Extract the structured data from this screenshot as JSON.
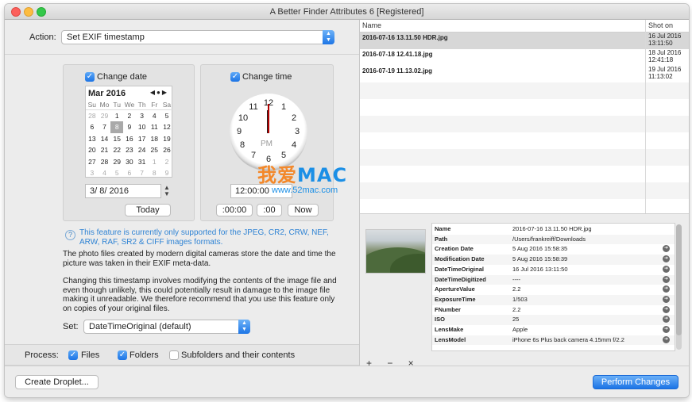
{
  "window": {
    "title": "A Better Finder Attributes 6 [Registered]"
  },
  "action": {
    "label": "Action:",
    "value": "Set EXIF timestamp"
  },
  "date_panel": {
    "checkbox_label": "Change date",
    "month": "Mar 2016",
    "weekdays": [
      "Su",
      "Mo",
      "Tu",
      "We",
      "Th",
      "Fr",
      "Sa"
    ],
    "days": [
      {
        "d": "28",
        "dim": true
      },
      {
        "d": "29",
        "dim": true
      },
      {
        "d": "1"
      },
      {
        "d": "2"
      },
      {
        "d": "3"
      },
      {
        "d": "4"
      },
      {
        "d": "5"
      },
      {
        "d": "6"
      },
      {
        "d": "7"
      },
      {
        "d": "8",
        "sel": true
      },
      {
        "d": "9"
      },
      {
        "d": "10"
      },
      {
        "d": "11"
      },
      {
        "d": "12"
      },
      {
        "d": "13"
      },
      {
        "d": "14"
      },
      {
        "d": "15"
      },
      {
        "d": "16"
      },
      {
        "d": "17"
      },
      {
        "d": "18"
      },
      {
        "d": "19"
      },
      {
        "d": "20"
      },
      {
        "d": "21"
      },
      {
        "d": "22"
      },
      {
        "d": "23"
      },
      {
        "d": "24"
      },
      {
        "d": "25"
      },
      {
        "d": "26"
      },
      {
        "d": "27"
      },
      {
        "d": "28"
      },
      {
        "d": "29"
      },
      {
        "d": "30"
      },
      {
        "d": "31"
      },
      {
        "d": "1",
        "dim": true
      },
      {
        "d": "2",
        "dim": true
      },
      {
        "d": "3",
        "dim": true
      },
      {
        "d": "4",
        "dim": true
      },
      {
        "d": "5",
        "dim": true
      },
      {
        "d": "6",
        "dim": true
      },
      {
        "d": "7",
        "dim": true
      },
      {
        "d": "8",
        "dim": true
      },
      {
        "d": "9",
        "dim": true
      }
    ],
    "date_value": "3/  8/ 2016",
    "today_button": "Today"
  },
  "time_panel": {
    "checkbox_label": "Change time",
    "clock_numbers": [
      "12",
      "1",
      "2",
      "3",
      "4",
      "5",
      "6",
      "7",
      "8",
      "9",
      "10",
      "11"
    ],
    "pm_label": "PM",
    "time_value": "12:00:00",
    "btn_min": ":00:00",
    "btn_sec": ":00",
    "btn_now": "Now"
  },
  "info_icon": "?",
  "info_text": "This feature is currently only supported for the JPEG, CR2, CRW, NEF, ARW, RAF, SR2 & CIFF images formats.",
  "para1": "The photo files created by modern digital cameras store the date and time the picture was taken in their EXIF meta-data.",
  "para2": "Changing this timestamp involves modifying the contents of the image file and even though unlikely, this could potentially result in damage to the image file making it unreadable. We therefore recommend that you use this feature only on copies of your original files.",
  "set": {
    "label": "Set:",
    "value": "DateTimeOriginal (default)"
  },
  "process": {
    "label": "Process:",
    "files": "Files",
    "folders": "Folders",
    "subfolders": "Subfolders and their contents"
  },
  "bottom": {
    "create_droplet": "Create Droplet...",
    "perform": "Perform Changes"
  },
  "file_table": {
    "col_name": "Name",
    "col_shot": "Shot on",
    "rows": [
      {
        "name": "2016-07-16 13.11.50 HDR.jpg",
        "date1": "16 Jul 2016",
        "date2": "13:11:50"
      },
      {
        "name": "2016-07-18 12.41.18.jpg",
        "date1": "18 Jul 2016",
        "date2": "12:41:18"
      },
      {
        "name": "2016-07-19 11.13.02.jpg",
        "date1": "19 Jul 2016",
        "date2": "11:13:02"
      }
    ]
  },
  "metadata": {
    "rows": [
      {
        "k": "Name",
        "v": "2016-07-16 13.11.50 HDR.jpg",
        "arrow": false
      },
      {
        "k": "Path",
        "v": "/Users/frankreiff/Downloads",
        "arrow": false
      },
      {
        "k": "Creation Date",
        "v": "5 Aug 2016 15:58:35",
        "arrow": true
      },
      {
        "k": "Modification Date",
        "v": "5 Aug 2016 15:58:39",
        "arrow": true
      },
      {
        "k": "DateTimeOriginal",
        "v": "16 Jul 2016 13:11:50",
        "arrow": true
      },
      {
        "k": "DateTimeDigitized",
        "v": "----",
        "arrow": true
      },
      {
        "k": "ApertureValue",
        "v": "2.2",
        "arrow": true
      },
      {
        "k": "ExposureTime",
        "v": "1/503",
        "arrow": true
      },
      {
        "k": "FNumber",
        "v": "2.2",
        "arrow": true
      },
      {
        "k": "ISO",
        "v": "25",
        "arrow": true
      },
      {
        "k": "LensMake",
        "v": "Apple",
        "arrow": true
      },
      {
        "k": "LensModel",
        "v": "iPhone 6s Plus back camera 4.15mm f/2.2",
        "arrow": true
      }
    ],
    "tools": "+ − ×"
  },
  "watermark": {
    "big_cn": "我爱",
    "big_en": "MAC",
    "url": "www.52mac.com"
  }
}
